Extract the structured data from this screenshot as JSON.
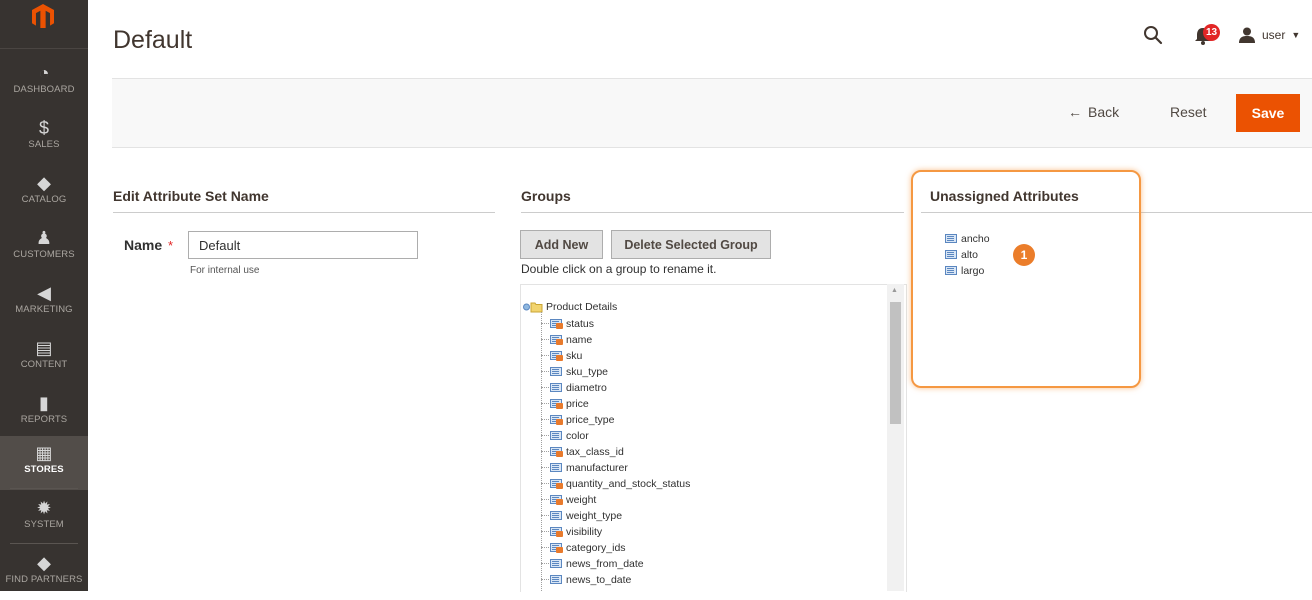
{
  "sidebar": {
    "items": [
      {
        "label": "Dashboard",
        "icon": "speedometer-icon"
      },
      {
        "label": "Sales",
        "icon": "dollar-icon"
      },
      {
        "label": "Catalog",
        "icon": "cube-icon"
      },
      {
        "label": "Customers",
        "icon": "person-icon"
      },
      {
        "label": "Marketing",
        "icon": "megaphone-icon"
      },
      {
        "label": "Content",
        "icon": "layout-icon"
      },
      {
        "label": "Reports",
        "icon": "bar-chart-icon"
      },
      {
        "label": "Stores",
        "icon": "storefront-icon",
        "active": true
      },
      {
        "label": "System",
        "icon": "gear-icon"
      },
      {
        "label": "Find Partners",
        "icon": "cube-icon"
      }
    ]
  },
  "header": {
    "title": "Default",
    "notification_count": "13",
    "user_label": "user"
  },
  "actions": {
    "back_label": "Back",
    "reset_label": "Reset",
    "save_label": "Save"
  },
  "edit_set": {
    "section_title": "Edit Attribute Set Name",
    "name_label": "Name",
    "name_value": "Default",
    "name_note": "For internal use"
  },
  "groups": {
    "section_title": "Groups",
    "add_new_label": "Add New",
    "delete_label": "Delete Selected Group",
    "hint": "Double click on a group to rename it.",
    "tree_root": "Product Details",
    "nodes": [
      {
        "label": "status",
        "type": "system"
      },
      {
        "label": "name",
        "type": "system"
      },
      {
        "label": "sku",
        "type": "system"
      },
      {
        "label": "sku_type",
        "type": "user"
      },
      {
        "label": "diametro",
        "type": "user"
      },
      {
        "label": "price",
        "type": "system"
      },
      {
        "label": "price_type",
        "type": "system"
      },
      {
        "label": "color",
        "type": "user"
      },
      {
        "label": "tax_class_id",
        "type": "system"
      },
      {
        "label": "manufacturer",
        "type": "user"
      },
      {
        "label": "quantity_and_stock_status",
        "type": "system"
      },
      {
        "label": "weight",
        "type": "system"
      },
      {
        "label": "weight_type",
        "type": "user"
      },
      {
        "label": "visibility",
        "type": "system"
      },
      {
        "label": "category_ids",
        "type": "system"
      },
      {
        "label": "news_from_date",
        "type": "user"
      },
      {
        "label": "news_to_date",
        "type": "user"
      }
    ]
  },
  "unassigned": {
    "section_title": "Unassigned Attributes",
    "items": [
      "ancho",
      "alto",
      "largo"
    ],
    "callout_number": "1",
    "highlight_color": "#f59842"
  },
  "colors": {
    "accent": "#eb5202",
    "sidebar_bg": "#373330",
    "badge": "#e22626"
  }
}
